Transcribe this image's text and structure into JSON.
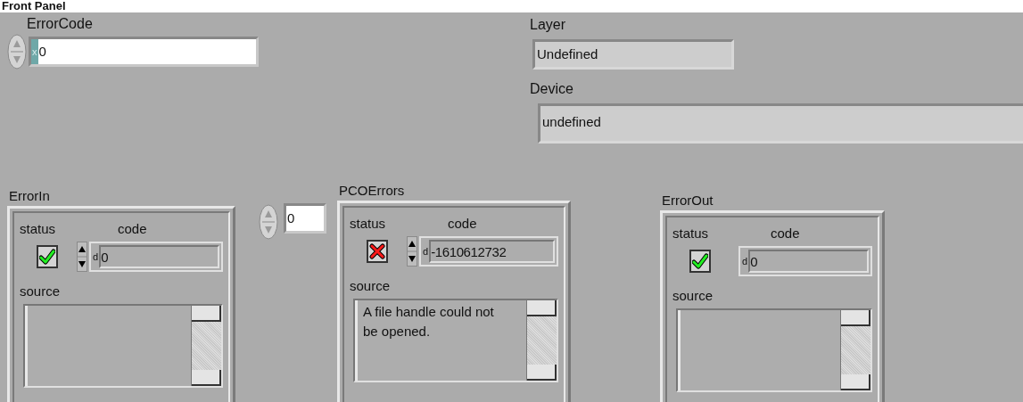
{
  "title": "Front Panel",
  "error_code": {
    "label": "ErrorCode",
    "radix": "x",
    "value": "0"
  },
  "layer": {
    "label": "Layer",
    "value": "Undefined"
  },
  "device": {
    "label": "Device",
    "value": "undefined"
  },
  "index": {
    "value": "0"
  },
  "clusters": [
    {
      "label": "ErrorIn",
      "kind": "control",
      "status_label": "status",
      "code_label": "code",
      "source_label": "source",
      "error": false,
      "radix": "d",
      "code": "0"
    },
    {
      "label": "PCOErrors",
      "kind": "control",
      "status_label": "status",
      "code_label": "code",
      "source_label": "source",
      "error": true,
      "radix": "d",
      "code": "-1610612732",
      "source": "A file handle could not be opened."
    },
    {
      "label": "ErrorOut",
      "kind": "indicator",
      "status_label": "status",
      "code_label": "code",
      "source_label": "source",
      "error": false,
      "radix": "d",
      "code": "0"
    }
  ]
}
